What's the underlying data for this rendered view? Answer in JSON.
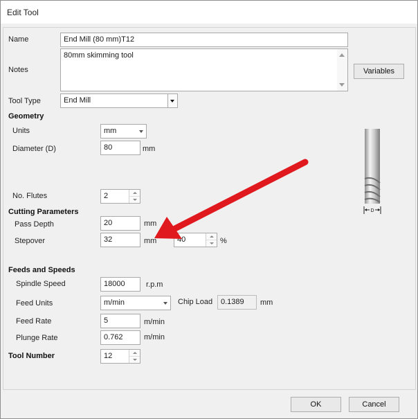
{
  "window": {
    "title": "Edit Tool"
  },
  "fields": {
    "name": {
      "label": "Name",
      "value": "End Mill (80 mm)T12"
    },
    "notes": {
      "label": "Notes",
      "value": "80mm skimming tool"
    },
    "variables_button": "Variables",
    "tool_type": {
      "label": "Tool Type",
      "value": "End Mill"
    }
  },
  "geometry": {
    "header": "Geometry",
    "units": {
      "label": "Units",
      "value": "mm"
    },
    "diameter": {
      "label": "Diameter (D)",
      "value": "80",
      "unit": "mm"
    },
    "flutes": {
      "label": "No. Flutes",
      "value": "2"
    }
  },
  "cutting": {
    "header": "Cutting Parameters",
    "pass_depth": {
      "label": "Pass Depth",
      "value": "20",
      "unit": "mm"
    },
    "stepover": {
      "label": "Stepover",
      "value": "32",
      "unit": "mm",
      "percent": "40",
      "percent_unit": "%"
    }
  },
  "feeds": {
    "header": "Feeds and Speeds",
    "spindle_speed": {
      "label": "Spindle Speed",
      "value": "18000",
      "unit": "r.p.m"
    },
    "feed_units": {
      "label": "Feed Units",
      "value": "m/min"
    },
    "chip_load": {
      "label": "Chip Load",
      "value": "0.1389",
      "unit": "mm"
    },
    "feed_rate": {
      "label": "Feed Rate",
      "value": "5",
      "unit": "m/min"
    },
    "plunge_rate": {
      "label": "Plunge Rate",
      "value": "0.762",
      "unit": "m/min"
    }
  },
  "tool_number": {
    "header": "Tool Number",
    "value": "12"
  },
  "diagram": {
    "dimension_label": "D"
  },
  "footer": {
    "ok": "OK",
    "cancel": "Cancel"
  },
  "colors": {
    "annotation_arrow": "#e0191f"
  }
}
